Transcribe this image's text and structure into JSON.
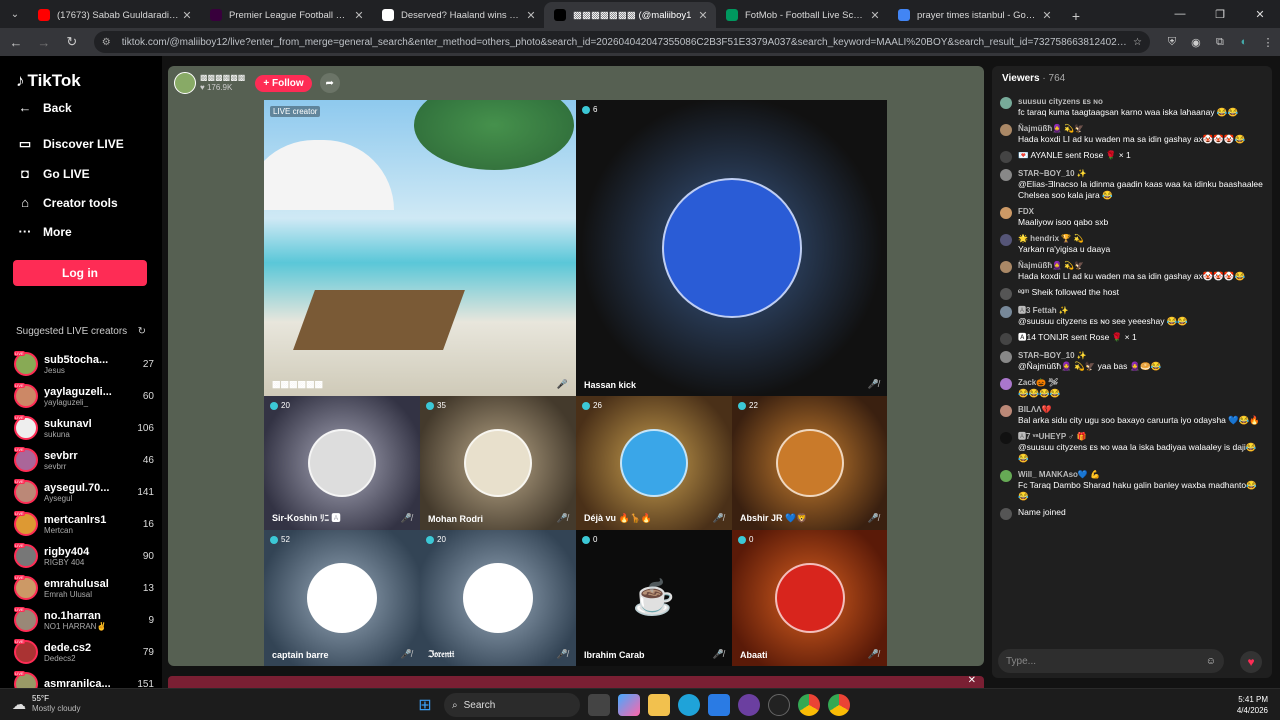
{
  "browser": {
    "tabs": [
      {
        "title": "(17673) Sabab Guuldaradii City",
        "fav": "#ff0000"
      },
      {
        "title": "Premier League Football News",
        "fav": "#38003c"
      },
      {
        "title": "Deserved? Haaland wins UEFA",
        "fav": "#ffffff"
      },
      {
        "title": "▩▩▩▩▩▩▩ (@maliiboy1",
        "fav": "#000000",
        "active": true
      },
      {
        "title": "FotMob - Football Live Scores",
        "fav": "#00985f"
      },
      {
        "title": "prayer times istanbul - Google",
        "fav": "#4285f4"
      }
    ],
    "url": "tiktok.com/@maliiboy12/live?enter_from_merge=general_search&enter_method=others_photo&search_id=20260404204735508​6C2B3F51E3379A037&search_keyword=MAALI%20BOY&search_result_id=7327586638124024838&search_type=..."
  },
  "sidebar": {
    "logo": "TikTok",
    "nav": [
      {
        "label": "Back",
        "icon": "←"
      },
      {
        "label": "Discover LIVE",
        "icon": "▭"
      },
      {
        "label": "Go LIVE",
        "icon": "◘"
      },
      {
        "label": "Creator tools",
        "icon": "⌂"
      },
      {
        "label": "More",
        "icon": "···"
      }
    ],
    "login": "Log in",
    "suggested_title": "Suggested LIVE creators",
    "creators": [
      {
        "name": "sub5tocha...",
        "sub": "Jesus",
        "count": "27",
        "color": "#8a5"
      },
      {
        "name": "yaylaguzeli...",
        "sub": "yaylaguzeli_",
        "count": "60",
        "color": "#c86"
      },
      {
        "name": "sukunavl",
        "sub": "sukuna",
        "count": "106",
        "color": "#eee"
      },
      {
        "name": "sevbrr",
        "sub": "sevbrr",
        "count": "46",
        "color": "#a69"
      },
      {
        "name": "aysegul.70...",
        "sub": "Aysegul",
        "count": "141",
        "color": "#b87"
      },
      {
        "name": "mertcanlrs1",
        "sub": "Mertcan",
        "count": "16",
        "color": "#d93"
      },
      {
        "name": "rigby404",
        "sub": "RIGBY 404",
        "count": "90",
        "color": "#777"
      },
      {
        "name": "emrahulusal",
        "sub": "Emrah Ulusal",
        "count": "13",
        "color": "#c96"
      },
      {
        "name": "no.1harran",
        "sub": "NO1 HARRAN✌",
        "count": "9",
        "color": "#987"
      },
      {
        "name": "dede.cs2",
        "sub": "Dedecs2",
        "count": "79",
        "color": "#a33"
      },
      {
        "name": "asmranilca...",
        "sub": "",
        "count": "151",
        "color": "#996"
      }
    ]
  },
  "stage": {
    "host_name": "▩▩▩▩▩▩",
    "host_likes": "♥ 176.9K",
    "follow": "+ Follow",
    "cells": [
      {
        "name": "",
        "label": "LIVE creator",
        "count": "",
        "sub": "▩▩▩▩▩▩"
      },
      {
        "name": "Hassan kick",
        "count": "6"
      },
      {
        "name": "Sir-Koshin ﾘﾆ 🅰",
        "count": "20"
      },
      {
        "name": "Mohan Rodri",
        "count": "35"
      },
      {
        "name": "Déjà vu 🔥🦒🔥",
        "count": "26"
      },
      {
        "name": "Abshir JR 💙🦁",
        "count": "22"
      },
      {
        "name": "captain barre",
        "count": "52"
      },
      {
        "name": "ℑ𝔬𝔯𝔢𝔫𝔱𝔦",
        "count": "20"
      },
      {
        "name": "Ibrahim Carab",
        "count": "0"
      },
      {
        "name": "Abaati",
        "count": "0"
      }
    ]
  },
  "chat": {
    "viewers_label": "Viewers",
    "viewers_count": "· 764",
    "messages": [
      {
        "who": "suusuu cityzens ᴇs ɴᴏ",
        "text": "fc taraq kuma taagtaagsan karno waa iska lahaanay 😂😂",
        "color": "#7a9"
      },
      {
        "who": "Ñajmüßħ🧕 💫🦅",
        "text": "Hada koxdi LI ad ku waden ma sa idin gashay ax🤡🤡🤡😂",
        "color": "#a86"
      },
      {
        "who": "",
        "text": "💌 AYANLE sent Rose 🌹 × 1",
        "color": "#444"
      },
      {
        "who": "STAR~BOY_10 ✨",
        "text": "@Elias-Ǝlnacso la idinma gaadin kaas waa ka idinku baashaalee Chelsea soo kala jara 😂",
        "color": "#888"
      },
      {
        "who": "FDX",
        "text": "Maaliyow isoo qabo sxb",
        "color": "#c96"
      },
      {
        "who": "🌟 hendrix 🏆 💫",
        "text": "Yarkan ra'yigisa u daaya",
        "color": "#557"
      },
      {
        "who": "Ñajmüßħ🧕 💫🦅",
        "text": "Hada koxdi LI ad ku waden ma sa idin gashay ax🤡🤡🤡😂",
        "color": "#a86"
      },
      {
        "who": "",
        "text": "ᵉᵍᵐ Sheik  followed the host",
        "color": "#555"
      },
      {
        "who": "🅰3 Fettah ✨",
        "text": "@suusuu cityzens ᴇs ɴᴏ see yeeeshay 😂😂",
        "color": "#789"
      },
      {
        "who": "",
        "text": "🅰14 TONIJR sent Rose 🌹 × 1",
        "color": "#444"
      },
      {
        "who": "STAR~BOY_10 ✨",
        "text": "@Ñajmüßħ🧕 💫🦅 yaa bas 🧕🥯😂",
        "color": "#888"
      },
      {
        "who": "Zack🎃 🛩",
        "text": "😂😂😂😂",
        "color": "#a7c"
      },
      {
        "who": "BILΛΛ💔",
        "text": "Bal arka sidu city ugu soo baxayo caruurta iyo odaysha 💙😂🔥",
        "color": "#b87"
      },
      {
        "who": "🅰7 ᵛᵃUHEYP ♂ 🎁",
        "text": "@suusuu cityzens ᴇs ɴᴏ waa la iska badiyaa walaaley is daji😂😂",
        "color": "#111"
      },
      {
        "who": "Will_ MANKAso💙 💪",
        "text": "Fc Taraq Dambo Sharad haku galin banley waxba madhanto😂😂",
        "color": "#6a5"
      },
      {
        "who": "",
        "text": "Name  joined",
        "color": "#555"
      }
    ],
    "placeholder": "Type..."
  },
  "taskbar": {
    "temp": "55°F",
    "weather": "Mostly cloudy",
    "search": "Search",
    "time": "5:41 PM",
    "date": "4/4/2026"
  }
}
